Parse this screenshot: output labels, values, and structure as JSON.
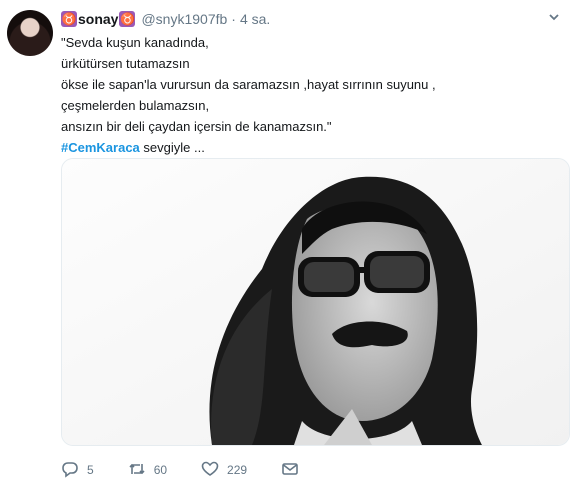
{
  "user": {
    "symbol": "♉",
    "display_name": "sonay",
    "handle": "@snyk1907fb",
    "separator": "·",
    "time": "4 sa."
  },
  "tweet": {
    "lines": [
      "\"Sevda kuşun kanadında,",
      "ürkütürsen tutamazsın",
      "ökse ile sapan'la vurursun da saramazsın ,hayat sırrının suyunu ,",
      "çeşmelerden bulamazsın,",
      "ansızın bir deli çaydan içersin de kanamazsın.\""
    ],
    "hashtag": "#CemKaraca",
    "after_hashtag": " sevgiyle ..."
  },
  "actions": {
    "reply_count": "5",
    "retweet_count": "60",
    "like_count": "229"
  },
  "icons": {
    "avatar": "avatar",
    "menu": "chevron-down-icon",
    "reply": "reply-icon",
    "retweet": "retweet-icon",
    "like": "heart-icon",
    "message": "envelope-icon"
  },
  "colors": {
    "accent": "#1b95e0",
    "secondary_text": "#657786",
    "symbol_bg": "#9b59b6"
  }
}
